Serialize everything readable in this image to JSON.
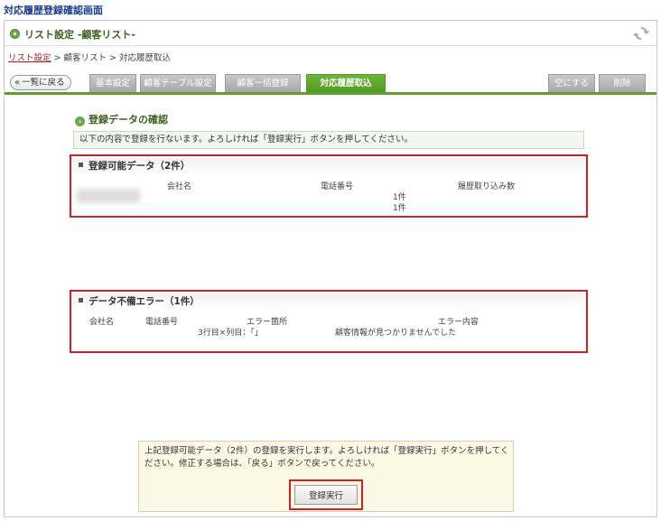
{
  "page_title": "対応履歴登録確認画面",
  "header": {
    "title": "リスト設定 -顧客リスト-",
    "refresh_icon": "refresh-icon"
  },
  "breadcrumb": {
    "link": "リスト設定",
    "sep1": " > ",
    "item2": "顧客リスト",
    "sep2": " > ",
    "item3": "対応履歴取込"
  },
  "nav": {
    "back_label": "一覧に戻る",
    "tabs": [
      "基本設定",
      "顧客テーブル設定",
      "顧客一括登録",
      "対応履歴取込"
    ],
    "active_tab": "対応履歴取込",
    "right_buttons": [
      "空にする",
      "削除"
    ]
  },
  "section": {
    "title": "登録データの確認",
    "notice": "以下の内容で登録を行ないます。よろしければ「登録実行」ボタンを押してください。"
  },
  "valid_panel": {
    "title": "登録可能データ（2件）",
    "columns": [
      "会社名",
      "電話番号",
      "履歴取り込み数"
    ],
    "rows": [
      {
        "company": "",
        "phone": "",
        "count": "1件"
      },
      {
        "company": "",
        "phone": "",
        "count": "1件"
      }
    ]
  },
  "error_panel": {
    "title": "データ不備エラー（1件）",
    "columns": [
      "会社名",
      "電話番号",
      "エラー箇所",
      "エラー内容"
    ],
    "rows": [
      {
        "company": "",
        "phone": "",
        "location": "3行目×列目：「」",
        "message": "顧客情報が見つかりませんでした"
      }
    ]
  },
  "confirm": {
    "text": "上記登録可能データ（2件）の登録を実行します。よろしければ「登録実行」ボタンを押してください。修正する場合は、「戻る」ボタンで戻ってください。",
    "execute_label": "登録実行"
  },
  "colors": {
    "accent_green": "#5ea02f",
    "highlight_red": "#d32020",
    "title_blue": "#1a3c8a"
  }
}
